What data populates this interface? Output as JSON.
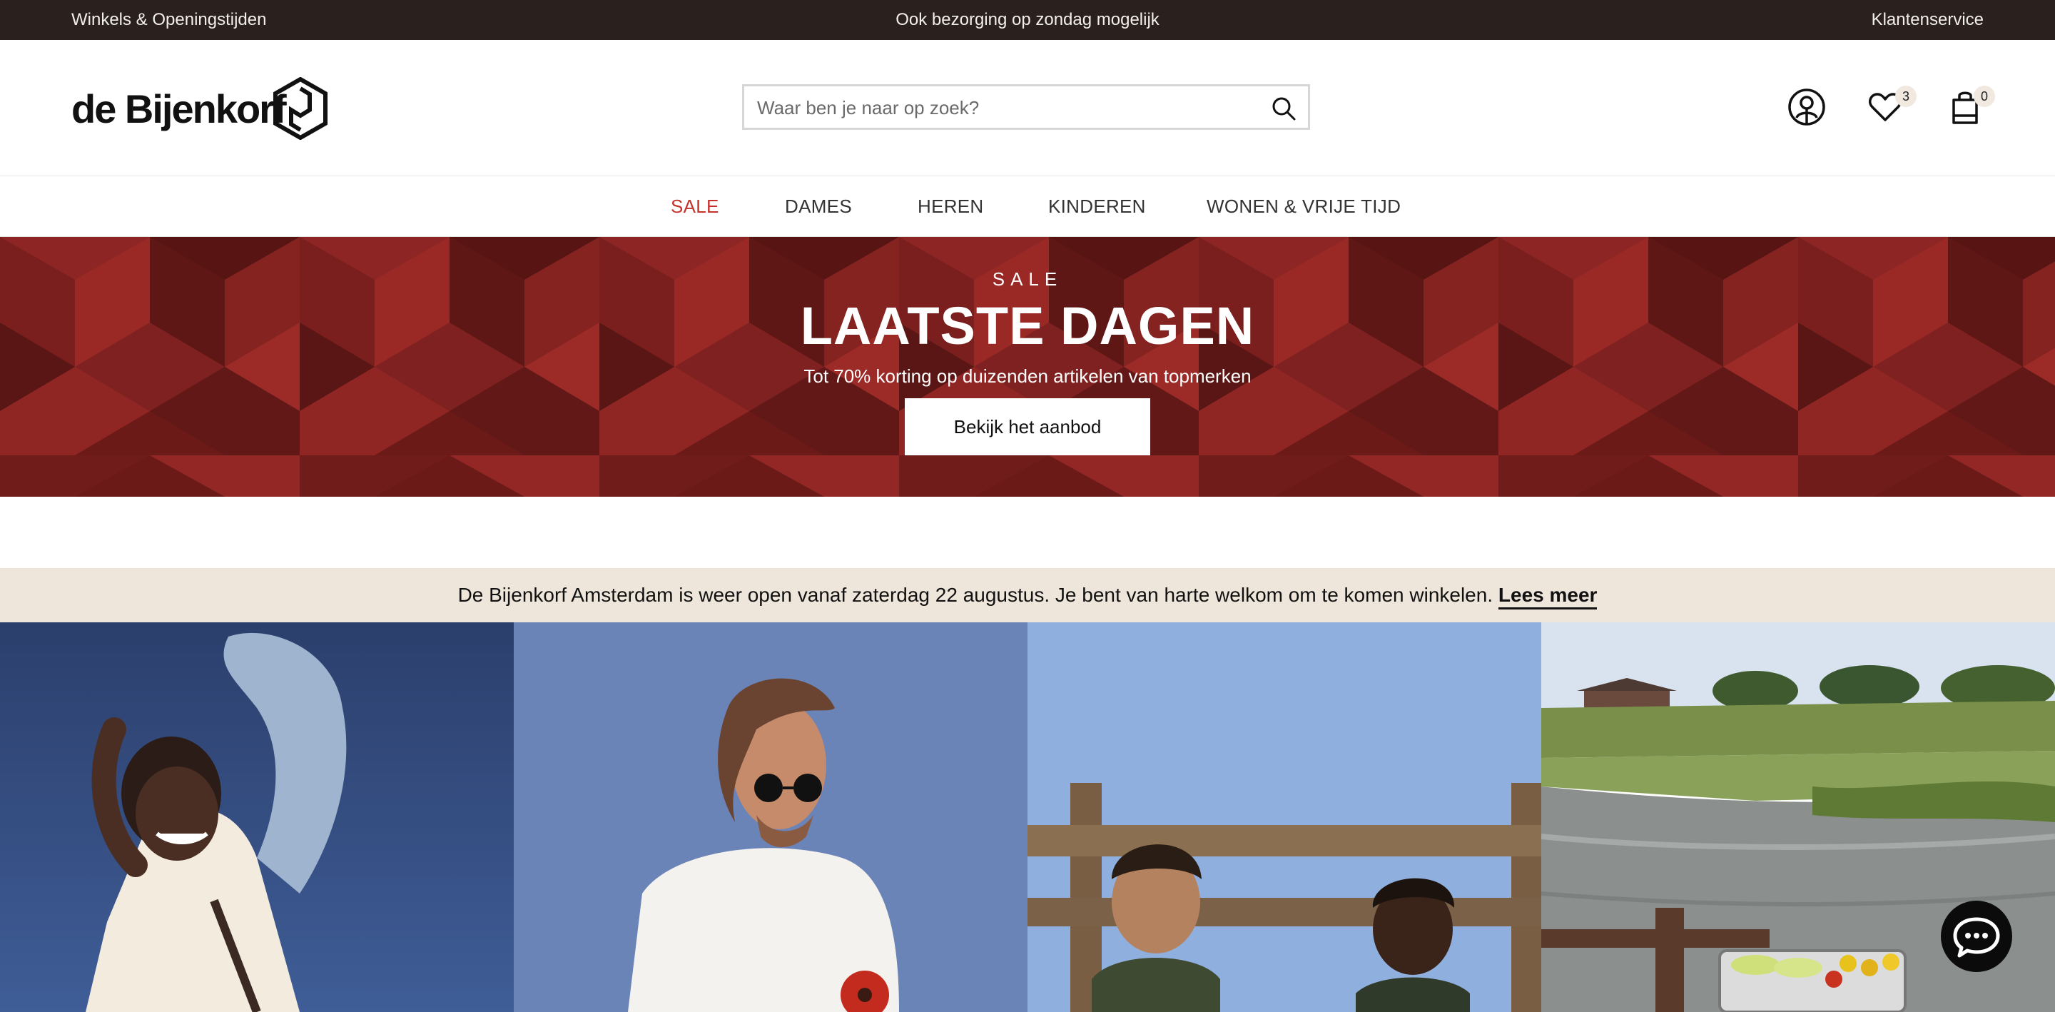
{
  "topbar": {
    "left_link": "Winkels & Openingstijden",
    "center_text": "Ook bezorging op zondag mogelijk",
    "right_link": "Klantenservice"
  },
  "header": {
    "logo_text": "de Bijenkorf",
    "search_placeholder": "Waar ben je naar op zoek?",
    "wishlist_count": "3",
    "cart_count": "0"
  },
  "nav": {
    "items": [
      {
        "label": "SALE"
      },
      {
        "label": "DAMES"
      },
      {
        "label": "HEREN"
      },
      {
        "label": "KINDEREN"
      },
      {
        "label": "WONEN & VRIJE TIJD"
      }
    ]
  },
  "hero": {
    "kicker": "SALE",
    "headline": "LAATSTE DAGEN",
    "subtitle": "Tot 70% korting op duizenden artikelen van topmerken",
    "cta_label": "Bekijk het aanbod"
  },
  "notice": {
    "text": "De Bijenkorf Amsterdam is weer open vanaf zaterdag 22 augustus. Je bent van harte welkom om te komen winkelen.",
    "link_label": "Lees meer"
  },
  "icons": {
    "search": "search-icon",
    "account": "user-icon",
    "wishlist": "heart-icon",
    "cart": "shopping-bag-icon",
    "chat": "chat-icon"
  },
  "colors": {
    "topbar_bg": "#2a211f",
    "sale_red": "#c6332b",
    "hero_bg": "#6e1a18",
    "notice_bg": "#efe6db"
  }
}
